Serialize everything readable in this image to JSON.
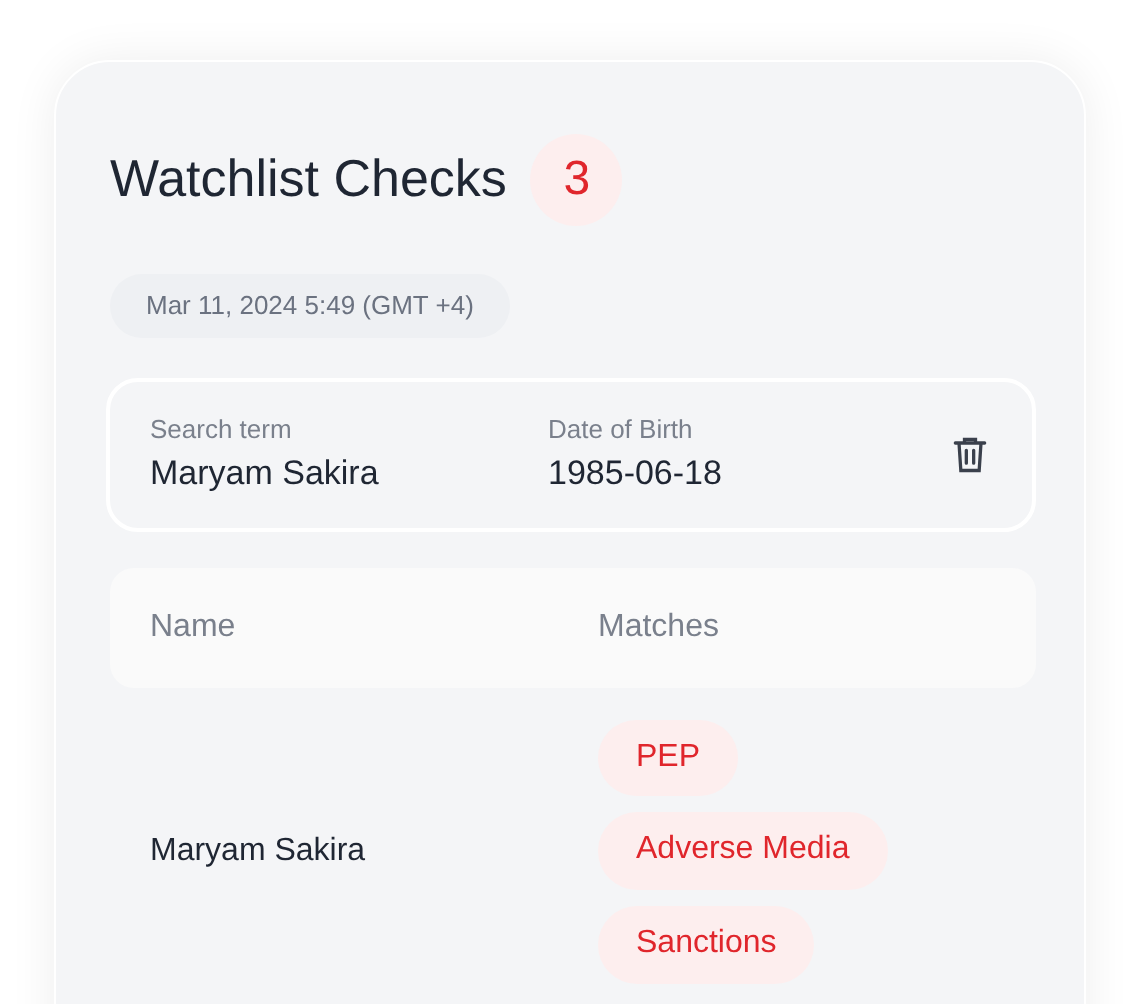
{
  "title": "Watchlist Checks",
  "count": "3",
  "timestamp": "Mar 11, 2024 5:49 (GMT +4)",
  "search": {
    "term_label": "Search term",
    "term": "Maryam Sakira",
    "dob_label": "Date of Birth",
    "dob": "1985-06-18"
  },
  "table": {
    "columns": [
      "Name",
      "Matches"
    ],
    "rows": [
      {
        "name": "Maryam Sakira",
        "matches": [
          "PEP",
          "Adverse Media",
          "Sanctions"
        ]
      }
    ]
  }
}
